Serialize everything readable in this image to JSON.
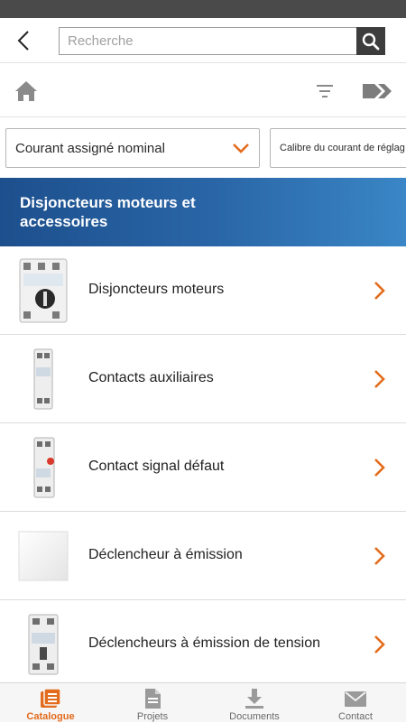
{
  "search": {
    "placeholder": "Recherche",
    "value": ""
  },
  "toolbar": {
    "home_icon": "home-icon",
    "filter_icon": "filter-icon",
    "next_icon": "double-chevron-icon"
  },
  "filters": [
    {
      "label": "Courant assigné nominal"
    },
    {
      "label": "Calibre du courant de réglag"
    }
  ],
  "category": {
    "title": "Disjoncteurs moteurs et accessoires"
  },
  "items": [
    {
      "label": "Disjoncteurs moteurs",
      "thumb": "motor-breaker-image"
    },
    {
      "label": "Contacts auxiliaires",
      "thumb": "aux-contact-image"
    },
    {
      "label": "Contact signal défaut",
      "thumb": "fault-contact-image"
    },
    {
      "label": "Déclencheur à émission",
      "thumb": "placeholder-image"
    },
    {
      "label": "Déclencheurs à émission de tension",
      "thumb": "shunt-trip-image"
    }
  ],
  "tabs": [
    {
      "label": "Catalogue",
      "icon": "catalogue-icon",
      "active": true
    },
    {
      "label": "Projets",
      "icon": "document-icon",
      "active": false
    },
    {
      "label": "Documents",
      "icon": "download-icon",
      "active": false
    },
    {
      "label": "Contact",
      "icon": "mail-icon",
      "active": false
    }
  ],
  "colors": {
    "accent": "#e36b1c",
    "header_start": "#1d4f8d",
    "header_end": "#3a86c6",
    "status_bar": "#4a4a4a",
    "search_button": "#3d3d3d"
  }
}
